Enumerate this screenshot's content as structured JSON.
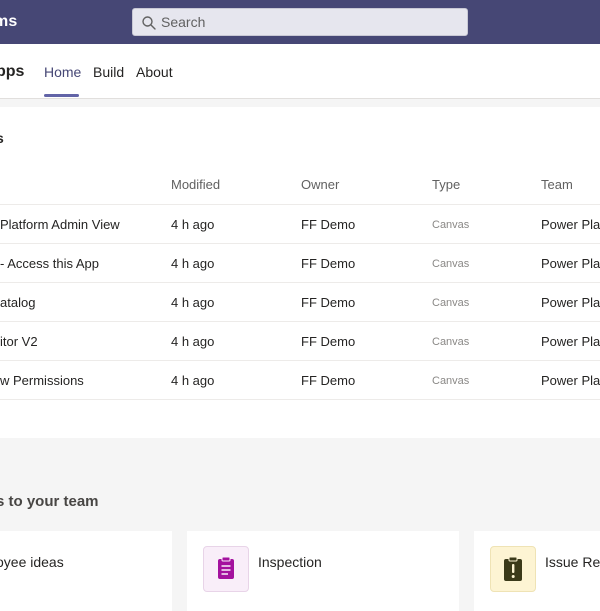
{
  "header": {
    "app_name": "ms",
    "search": {
      "placeholder": "Search"
    }
  },
  "subheader": {
    "title": "pps",
    "tabs": [
      {
        "label": "Home",
        "active": true
      },
      {
        "label": "Build",
        "active": false
      },
      {
        "label": "About",
        "active": false
      }
    ]
  },
  "recent_apps": {
    "title": "s",
    "columns": [
      "Modified",
      "Owner",
      "Type",
      "Team"
    ],
    "rows": [
      {
        "name": "Platform Admin View",
        "modified": "4 h ago",
        "owner": "FF Demo",
        "type": "Canvas",
        "team": "Power Plat"
      },
      {
        "name": "- Access this App",
        "modified": "4 h ago",
        "owner": "FF Demo",
        "type": "Canvas",
        "team": "Power Plat"
      },
      {
        "name": "atalog",
        "modified": "4 h ago",
        "owner": "FF Demo",
        "type": "Canvas",
        "team": "Power Plat"
      },
      {
        "name": "itor V2",
        "modified": "4 h ago",
        "owner": "FF Demo",
        "type": "Canvas",
        "team": "Power Plat"
      },
      {
        "name": "w Permissions",
        "modified": "4 h ago",
        "owner": "FF Demo",
        "type": "Canvas",
        "team": "Power Plat"
      }
    ]
  },
  "templates": {
    "title": "s to your team",
    "cards": [
      {
        "title": "oyee ideas",
        "icon": "lightbulb-icon"
      },
      {
        "title": "Inspection",
        "icon": "clipboard-icon",
        "icon_bg": "#f9eef9",
        "icon_color": "#a4119e"
      },
      {
        "title": "Issue Rep",
        "icon": "clipboard-alert-icon",
        "icon_bg": "#fdf4d3",
        "icon_color": "#3b3a19"
      }
    ]
  },
  "colors": {
    "topbar": "#464775",
    "accent": "#6264a7"
  }
}
